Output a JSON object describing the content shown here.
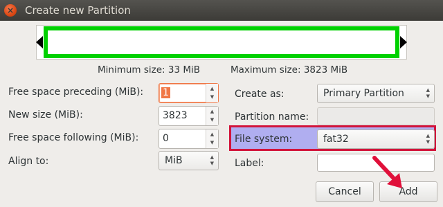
{
  "window": {
    "title": "Create new Partition",
    "close_symbol": "×"
  },
  "partition_bar": {
    "fill_color": "#00d100"
  },
  "sizes": {
    "minimum": "Minimum size: 33 MiB",
    "maximum": "Maximum size: 3823 MiB"
  },
  "left_form": {
    "free_preceding": {
      "label": "Free space preceding (MiB):",
      "value": "1"
    },
    "new_size": {
      "label": "New size (MiB):",
      "value": "3823"
    },
    "free_following": {
      "label": "Free space following (MiB):",
      "value": "0"
    },
    "align_to": {
      "label": "Align to:",
      "value": "MiB"
    }
  },
  "right_form": {
    "create_as": {
      "label": "Create as:",
      "value": "Primary Partition"
    },
    "partition_name": {
      "label": "Partition name:",
      "value": ""
    },
    "file_system": {
      "label": "File system:",
      "value": "fat32"
    },
    "label": {
      "label": "Label:",
      "value": ""
    }
  },
  "buttons": {
    "cancel": "Cancel",
    "add": "Add"
  },
  "glyphs": {
    "up": "▲",
    "down": "▼"
  },
  "colors": {
    "highlight_border": "#d2143a",
    "highlight_fill": "#b0aef0",
    "arrow": "#e0103a"
  }
}
